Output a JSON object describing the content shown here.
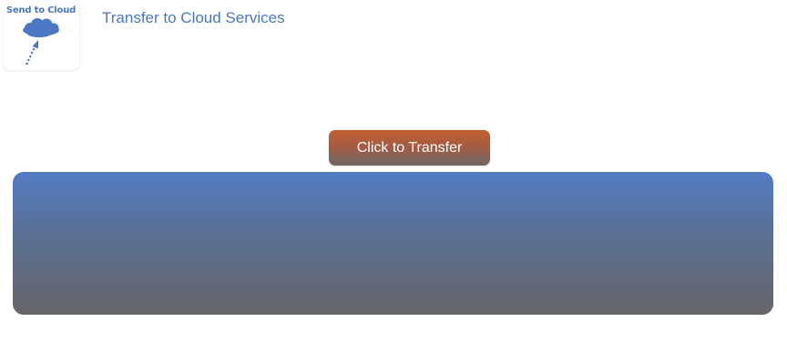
{
  "header": {
    "logo_text": "Send to Cloud",
    "logo_icon": "cloud-upload-icon",
    "title": "Transfer to Cloud Services"
  },
  "main": {
    "transfer_button_label": "Click to Transfer"
  },
  "colors": {
    "accent_blue": "#4a78c2",
    "button_orange": "#c35f33",
    "button_bottom": "#6e6767",
    "panel_top": "#527cc5",
    "panel_bottom": "#66656a"
  }
}
